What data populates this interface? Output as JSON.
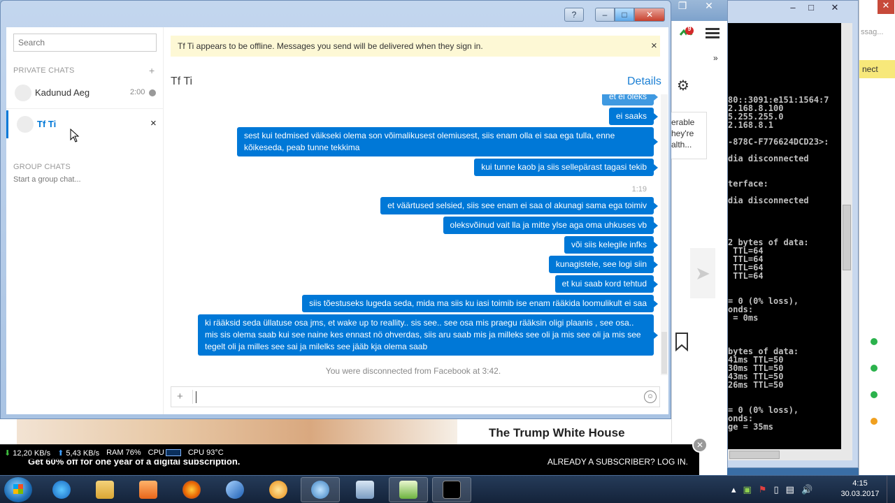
{
  "skype": {
    "help_label": "?",
    "search_placeholder": "Search",
    "private_chats_label": "PRIVATE CHATS",
    "group_chats_label": "GROUP CHATS",
    "add_label": "+",
    "start_group_chat": "Start a group chat...",
    "chats": [
      {
        "name": "Kadunud Aeg",
        "time": "2:00"
      },
      {
        "name": "Tf Ti"
      }
    ],
    "close_label": "×",
    "offline_banner": "Tf Ti appears to be offline.  Messages you send will be delivered when they sign in.",
    "conversation_title": "Tf Ti",
    "details_label": "Details",
    "messages": [
      "et ei oleks",
      "ei saaks",
      "sest kui tedmised väikseki olema son võimalikusest olemiusest, siis enam olla ei saa ega tulla, enne kõikeseda, peab tunne tekkima",
      "kui tunne kaob ja siis sellepärast tagasi tekib",
      "et väärtused selsied, siis see enam ei saa ol akunagi sama  ega toimiv",
      "oleksvõinud vait lla ja mitte ylse aga oma uhkuses vb",
      "või siis kelegile infks",
      "kunagistele, see logi siin",
      "et kui saab kord tehtud",
      "siis tõestuseks  lugeda seda, mida ma siis ku iasi toimib ise enam rääkida loomulikult ei saa",
      "ki rääksid seda üllatuse osa jms,  et wake up to reallity.. sis see.. see osa mis praegu rääksin oligi plaanis , see osa.. mis sis olema saab kui see naine kes ennast nö ohverdas, siis aru saab mis ja milleks see oli ja mis see oli ja mis see tegelt oli ja milles see sai ja milelks see jääb kja olema saab"
    ],
    "timestamp": "1:19",
    "disconnected_notice": "You were disconnected from Facebook at 3:42.",
    "composer_add": "+"
  },
  "status_bar": {
    "download": "12,20 KB/s",
    "upload": "5,43 KB/s",
    "ram": "RAM 76%",
    "cpu_label": "CPU",
    "cpu_temp": "CPU 93°C"
  },
  "background": {
    "badge_count": "9",
    "card_text": "erable hey're alth...",
    "headline": "The Trump White House",
    "promo_left": "Get 60% off for one year of a digital subscription.",
    "promo_right": "ALREADY A SUBSCRIBER? LOG IN.",
    "right_yellow": "nect",
    "right_message": "ssag..."
  },
  "cmd_lines": [
    "80::3091:e151:1564:7",
    "2.168.8.100",
    "5.255.255.0",
    "2.168.8.1",
    "",
    "-878C-F776624DCD23>:",
    "",
    "dia disconnected",
    "",
    "",
    "terface:",
    "",
    "dia disconnected",
    "",
    "",
    "",
    "",
    "2 bytes of data:",
    " TTL=64",
    " TTL=64",
    " TTL=64",
    " TTL=64",
    "",
    "",
    "= 0 (0% loss),",
    "onds:",
    " = 0ms",
    "",
    "",
    "",
    "bytes of data:",
    "41ms TTL=50",
    "30ms TTL=50",
    "43ms TTL=50",
    "26ms TTL=50",
    "",
    "",
    "= 0 (0% loss),",
    "onds:",
    "ge = 35ms"
  ],
  "taskbar": {
    "time": "4:15",
    "date": "30.03.2017"
  },
  "colors": {
    "skype_blue": "#0078d7",
    "offline_banner_bg": "#fdf8d5",
    "taskbar_bg": "#14233a"
  }
}
